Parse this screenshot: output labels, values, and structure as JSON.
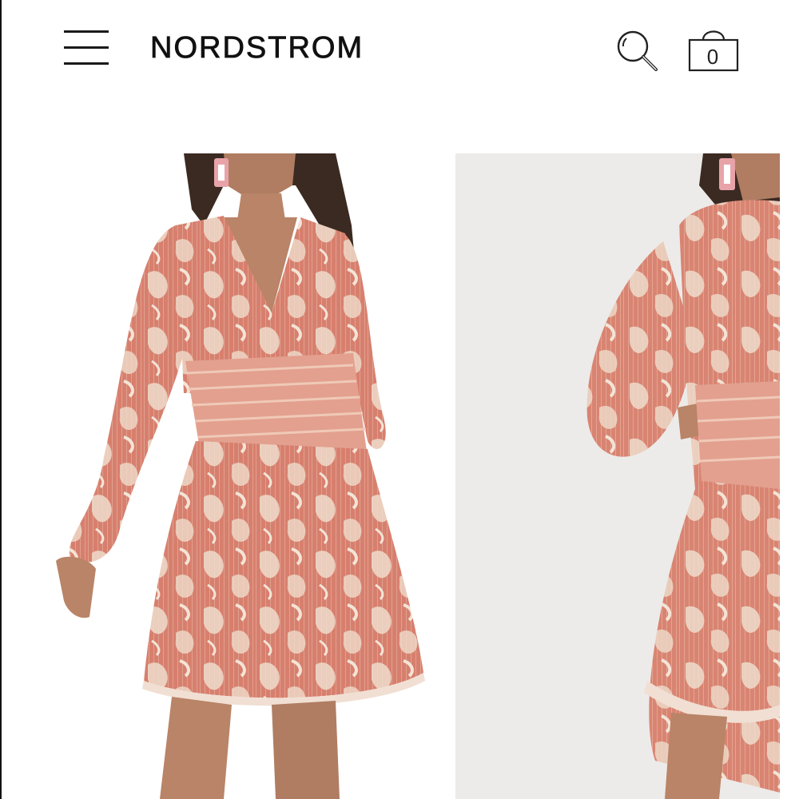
{
  "header": {
    "menu_icon": "hamburger-menu-icon",
    "brand": "NORDSTROM",
    "search_icon": "search-icon",
    "bag_icon": "shopping-bag-icon",
    "bag_count": "0"
  },
  "gallery": {
    "images": [
      {
        "description_icon": "product-photo-front"
      },
      {
        "description_icon": "product-photo-side"
      }
    ]
  },
  "colors": {
    "text": "#111111",
    "dress_base": "#d9806f",
    "dress_light": "#efdccb",
    "photo_bg_2": "#ecebe9"
  }
}
